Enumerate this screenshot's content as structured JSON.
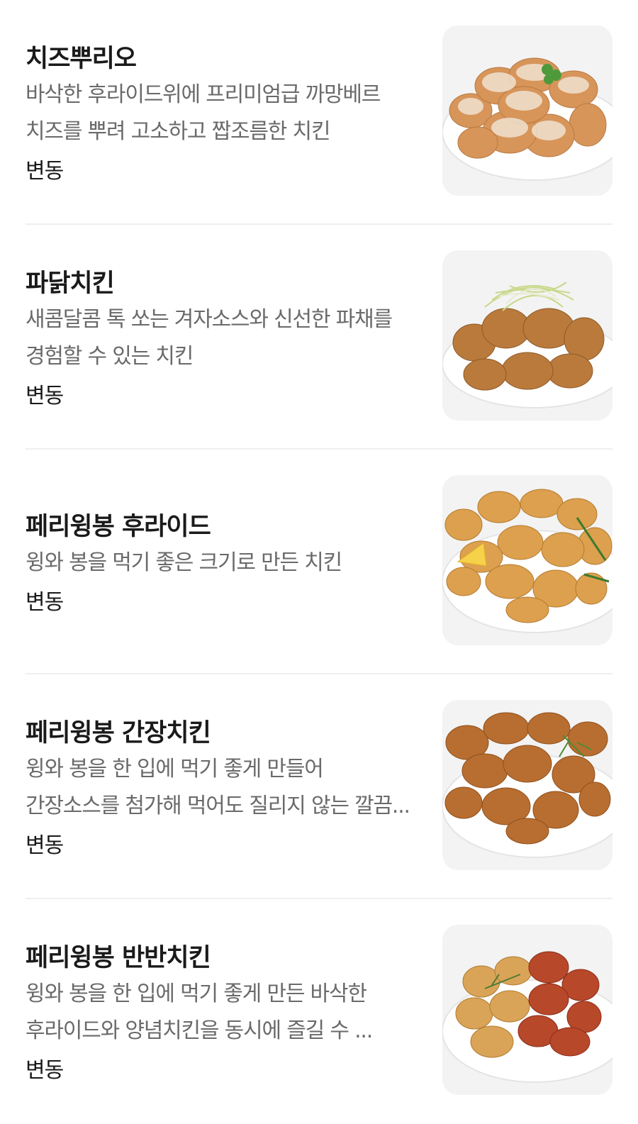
{
  "menu": {
    "items": [
      {
        "name": "치즈뿌리오",
        "description": "바삭한 후라이드위에 프리미엄급 까망베르 치즈를 뿌려 고소하고 짭조름한 치킨",
        "price": "변동",
        "image": "cheese-powder-chicken-photo"
      },
      {
        "name": "파닭치킨",
        "description": "새콤달콤 톡 쏘는 겨자소스와 신선한 파채를 경험할 수 있는 치킨",
        "price": "변동",
        "image": "green-onion-chicken-photo"
      },
      {
        "name": "페리윙봉 후라이드",
        "description": "윙와 봉을 먹기 좋은 크기로 만든 치킨",
        "price": "변동",
        "image": "fried-wings-photo"
      },
      {
        "name": "페리윙봉 간장치킨",
        "description": "윙와 봉을 한 입에 먹기 좋게 만들어 간장소스를 첨가해 먹어도 질리지 않는 깔끔...",
        "price": "변동",
        "image": "soy-sauce-wings-photo"
      },
      {
        "name": "페리윙봉 반반치킨",
        "description": "윙와 봉을 한 입에 먹기 좋게 만든 바삭한 후라이드와 양념치킨을 동시에 즐길 수 ...",
        "price": "변동",
        "image": "half-half-wings-photo"
      }
    ]
  },
  "colors": {
    "plate": "#ffffff",
    "thumb_bg": "#f3f3f3",
    "fried": "#d79a48",
    "soy": "#b46a2c",
    "sauce": "#b34e2c"
  }
}
